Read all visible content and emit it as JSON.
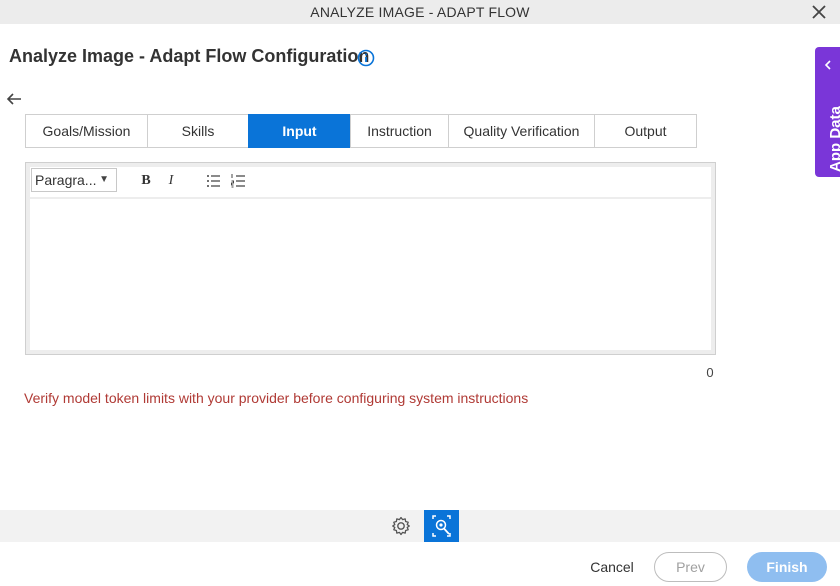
{
  "window": {
    "title": "ANALYZE IMAGE - ADAPT FLOW"
  },
  "header": {
    "title": "Analyze Image - Adapt Flow Configuration"
  },
  "tabs": [
    {
      "label": "Goals/Mission"
    },
    {
      "label": "Skills"
    },
    {
      "label": "Input",
      "active": true
    },
    {
      "label": "Instruction"
    },
    {
      "label": "Quality Verification"
    },
    {
      "label": "Output"
    }
  ],
  "editor": {
    "format_select": "Paragra...",
    "bold_label": "B",
    "italic_label": "I",
    "content": "",
    "char_count": "0"
  },
  "warning_text": "Verify model token limits with your provider before configuring system instructions",
  "side_panel": {
    "label": "App Data"
  },
  "footer": {
    "cancel_label": "Cancel",
    "prev_label": "Prev",
    "finish_label": "Finish"
  },
  "colors": {
    "accent": "#0a74d8",
    "app_data_tab": "#7a36d8",
    "warning": "#b03a35",
    "finish_disabled": "#8fbef0"
  },
  "icons": [
    "close-icon",
    "info-icon",
    "back-arrow-icon",
    "bullet-list-icon",
    "numbered-list-icon",
    "chevron-left-icon",
    "gear-icon",
    "ai-image-icon",
    "dropdown-arrow-icon"
  ]
}
